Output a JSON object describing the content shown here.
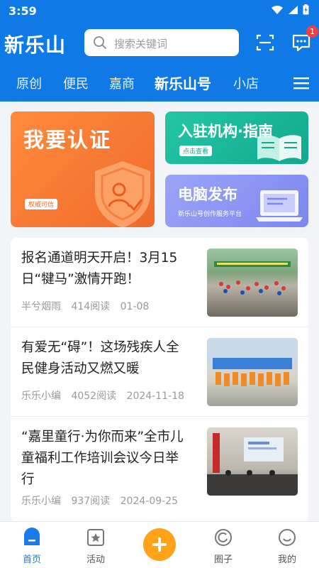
{
  "status": {
    "time": "3:59"
  },
  "header": {
    "logo": "新乐山",
    "search_placeholder": "搜索关键词",
    "message_badge": "1"
  },
  "tabs": [
    {
      "label": "原创"
    },
    {
      "label": "便民"
    },
    {
      "label": "嘉商"
    },
    {
      "label": "新乐山号",
      "active": true
    },
    {
      "label": "小店"
    }
  ],
  "banners": {
    "verify": {
      "title": "我要认证",
      "pill": "权威可信"
    },
    "join": {
      "title": "入驻机构·指南",
      "pill": "点击查看"
    },
    "pc": {
      "title": "电脑发布",
      "sub": "新乐山号创作服务平台"
    }
  },
  "feed": [
    {
      "title": "报名通道明天开启！3月15日“犍马”激情开跑！",
      "author": "半兮烟雨",
      "reads": "414阅读",
      "date": "01-08"
    },
    {
      "title": "有爱无“碍”！这场残疾人全民健身活动又燃又暖",
      "author": "乐乐小编",
      "reads": "4052阅读",
      "date": "2024-11-18"
    },
    {
      "title": "“嘉里童行·为你而来”全市儿童福利工作培训会议今日举行",
      "author": "乐乐小编",
      "reads": "937阅读",
      "date": "2024-09-25"
    }
  ],
  "nav": [
    {
      "label": "首页",
      "active": true
    },
    {
      "label": "活动"
    },
    {
      "label": ""
    },
    {
      "label": "圈子"
    },
    {
      "label": "我的"
    }
  ],
  "colors": {
    "brand": "#0f7ae5",
    "accent": "#ffa31a",
    "badge": "#f04141"
  }
}
